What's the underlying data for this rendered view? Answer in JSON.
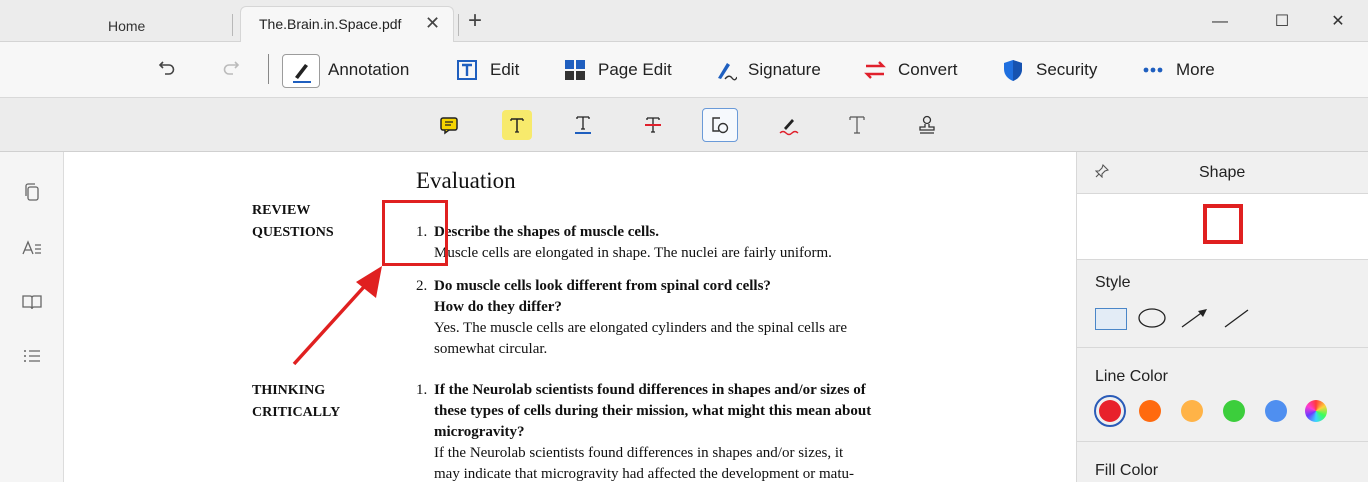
{
  "tabs": {
    "home": "Home",
    "active": "The.Brain.in.Space.pdf",
    "close_glyph": "✕",
    "new_tab_glyph": "+"
  },
  "window": {
    "minimize": "—",
    "maximize": "☐",
    "close": "✕"
  },
  "toolbar": {
    "annotation": "Annotation",
    "edit": "Edit",
    "page_edit": "Page Edit",
    "signature": "Signature",
    "convert": "Convert",
    "security": "Security",
    "more": "More"
  },
  "subtoolbar": {
    "tools": [
      "note-icon",
      "highlight-icon",
      "underline-icon",
      "strikethrough-icon",
      "shape-icon",
      "pencil-icon",
      "text-icon",
      "stamp-icon"
    ],
    "active_tool": "shape-icon"
  },
  "leftrail": [
    "pages-icon",
    "text-format-icon",
    "bookmark-icon",
    "outline-icon"
  ],
  "document": {
    "heading": "Evaluation",
    "review_label_line1": "REVIEW",
    "review_label_line2": "QUESTIONS",
    "q1_num": "1.",
    "q1_question": "Describe the shapes of muscle cells.",
    "q1_answer": "Muscle cells are elongated in shape. The nuclei are fairly uniform.",
    "q2_num": "2.",
    "q2_question_line1": "Do muscle cells look different from spinal cord cells?",
    "q2_question_line2": "How do they differ?",
    "q2_answer_line1": "Yes. The muscle cells are elongated cylinders and the spinal cells are",
    "q2_answer_line2": "somewhat circular.",
    "thinking_label_line1": "THINKING",
    "thinking_label_line2": "CRITICALLY",
    "t1_num": "1.",
    "t1_question_line1": "If the Neurolab scientists found differences in shapes and/or sizes of",
    "t1_question_line2": "these types of cells during their mission, what might this mean about",
    "t1_question_line3": "microgravity?",
    "t1_answer_line1": "If the Neurolab scientists found differences in shapes and/or sizes, it",
    "t1_answer_line2": "may indicate that microgravity had affected the development or matu-"
  },
  "rpanel": {
    "title": "Shape",
    "style_label": "Style",
    "line_color_label": "Line Color",
    "fill_color_label": "Fill Color",
    "line_colors": [
      "#e8212b",
      "#ff6a0f",
      "#ffb347",
      "#3cce3c",
      "#4f8ff0",
      "rainbow"
    ],
    "selected_color": "#e8212b"
  },
  "colors": {
    "annotation_red": "#e02020",
    "accent_blue": "#1f5fbf"
  }
}
